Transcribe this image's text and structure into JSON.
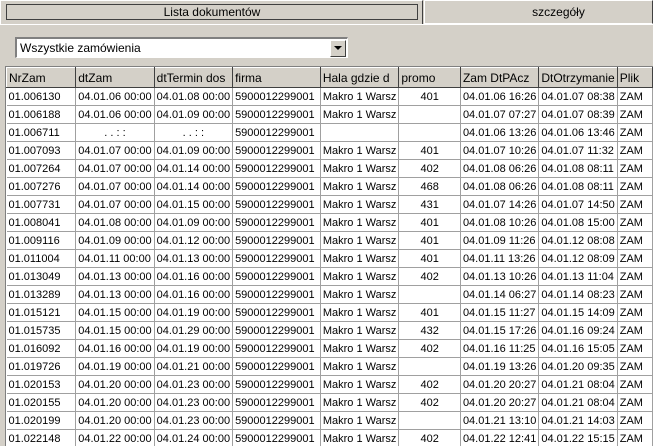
{
  "tabs": {
    "documents": "Lista dokumentów",
    "details": "szczegóły"
  },
  "filter": {
    "selected": "Wszystkie zamówienia"
  },
  "table": {
    "columns": [
      "NrZam",
      "dtZam",
      "dtTermin dos",
      "firma",
      "Hala gdzie d",
      "promo",
      "Zam DtPAcz",
      "DtOtrzymanie",
      "Plik"
    ],
    "rows": [
      [
        "01.006130",
        "04.01.06 00:00",
        "04.01.08 00:00",
        "5900012299001",
        "Makro 1 Warsz",
        "401",
        "04.01.06 16:26",
        "04.01.07 08:38",
        "ZAM"
      ],
      [
        "01.006188",
        "04.01.06 00:00",
        "04.01.09 00:00",
        "5900012299001",
        "Makro 1 Warsz",
        "",
        "04.01.07 07:27",
        "04.01.07 08:39",
        "ZAM"
      ],
      [
        "01.006711",
        ". .   : :",
        ". .   : :",
        "5900012299001",
        "",
        "",
        "04.01.06 13:26",
        "04.01.06 13:46",
        "ZAM"
      ],
      [
        "01.007093",
        "04.01.07 00:00",
        "04.01.09 00:00",
        "5900012299001",
        "Makro 1 Warsz",
        "401",
        "04.01.07 10:26",
        "04.01.07 11:32",
        "ZAM"
      ],
      [
        "01.007264",
        "04.01.07 00:00",
        "04.01.14 00:00",
        "5900012299001",
        "Makro 1 Warsz",
        "402",
        "04.01.08 06:26",
        "04.01.08 08:11",
        "ZAM"
      ],
      [
        "01.007276",
        "04.01.07 00:00",
        "04.01.14 00:00",
        "5900012299001",
        "Makro 1 Warsz",
        "468",
        "04.01.08 06:26",
        "04.01.08 08:11",
        "ZAM"
      ],
      [
        "01.007731",
        "04.01.07 00:00",
        "04.01.15 00:00",
        "5900012299001",
        "Makro 1 Warsz",
        "431",
        "04.01.07 14:26",
        "04.01.07 14:50",
        "ZAM"
      ],
      [
        "01.008041",
        "04.01.08 00:00",
        "04.01.09 00:00",
        "5900012299001",
        "Makro 1 Warsz",
        "401",
        "04.01.08 10:26",
        "04.01.08 15:00",
        "ZAM"
      ],
      [
        "01.009116",
        "04.01.09 00:00",
        "04.01.12 00:00",
        "5900012299001",
        "Makro 1 Warsz",
        "401",
        "04.01.09 11:26",
        "04.01.12 08:08",
        "ZAM"
      ],
      [
        "01.011004",
        "04.01.11 00:00",
        "04.01.13 00:00",
        "5900012299001",
        "Makro 1 Warsz",
        "401",
        "04.01.11 13:26",
        "04.01.12 08:09",
        "ZAM"
      ],
      [
        "01.013049",
        "04.01.13 00:00",
        "04.01.16 00:00",
        "5900012299001",
        "Makro 1 Warsz",
        "402",
        "04.01.13 10:26",
        "04.01.13 11:04",
        "ZAM"
      ],
      [
        "01.013289",
        "04.01.13 00:00",
        "04.01.16 00:00",
        "5900012299001",
        "Makro 1 Warsz",
        "",
        "04.01.14 06:27",
        "04.01.14 08:23",
        "ZAM"
      ],
      [
        "01.015121",
        "04.01.15 00:00",
        "04.01.19 00:00",
        "5900012299001",
        "Makro 1 Warsz",
        "401",
        "04.01.15 11:27",
        "04.01.15 14:09",
        "ZAM"
      ],
      [
        "01.015735",
        "04.01.15 00:00",
        "04.01.29 00:00",
        "5900012299001",
        "Makro 1 Warsz",
        "432",
        "04.01.15 17:26",
        "04.01.16 09:24",
        "ZAM"
      ],
      [
        "01.016092",
        "04.01.16 00:00",
        "04.01.19 00:00",
        "5900012299001",
        "Makro 1 Warsz",
        "402",
        "04.01.16 11:25",
        "04.01.16 15:05",
        "ZAM"
      ],
      [
        "01.019726",
        "04.01.19 00:00",
        "04.01.21 00:00",
        "5900012299001",
        "Makro 1 Warsz",
        "",
        "04.01.19 13:26",
        "04.01.20 09:35",
        "ZAM"
      ],
      [
        "01.020153",
        "04.01.20 00:00",
        "04.01.23 00:00",
        "5900012299001",
        "Makro 1 Warsz",
        "402",
        "04.01.20 20:27",
        "04.01.21 08:04",
        "ZAM"
      ],
      [
        "01.020155",
        "04.01.20 00:00",
        "04.01.23 00:00",
        "5900012299001",
        "Makro 1 Warsz",
        "402",
        "04.01.20 20:27",
        "04.01.21 08:04",
        "ZAM"
      ],
      [
        "01.020199",
        "04.01.20 00:00",
        "04.01.23 00:00",
        "5900012299001",
        "Makro 1 Warsz",
        "",
        "04.01.21 13:10",
        "04.01.21 14:03",
        "ZAM"
      ],
      [
        "01.022148",
        "04.01.22 00:00",
        "04.01.24 00:00",
        "5900012299001",
        "Makro 1 Warsz",
        "402",
        "04.01.22 12:41",
        "04.01.22 15:15",
        "ZAM"
      ]
    ]
  }
}
